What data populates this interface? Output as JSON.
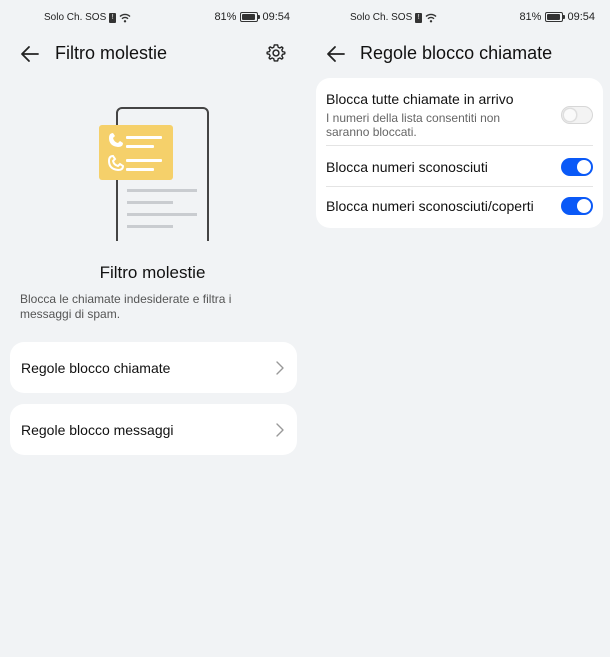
{
  "left": {
    "status": {
      "carrier": "Solo Ch. SOS",
      "battery": "81%",
      "time": "09:54"
    },
    "title": "Filtro molestie",
    "heading": "Filtro molestie",
    "description": "Blocca le chiamate indesiderate e filtra i messaggi di spam.",
    "rows": [
      {
        "label": "Regole blocco chiamate"
      },
      {
        "label": "Regole blocco messaggi"
      }
    ]
  },
  "right": {
    "status": {
      "carrier": "Solo Ch. SOS",
      "battery": "81%",
      "time": "09:54"
    },
    "title": "Regole blocco chiamate",
    "settings": [
      {
        "label": "Blocca tutte chiamate in arrivo",
        "sub": "I numeri della lista consentiti non saranno bloccati.",
        "on": false
      },
      {
        "label": "Blocca numeri sconosciuti",
        "on": true
      },
      {
        "label": "Blocca numeri sconosciuti/coperti",
        "on": true
      }
    ]
  },
  "colors": {
    "accent": "#0a59f7",
    "background": "#f1f3f5",
    "illustration": "#f5d06a"
  },
  "battery_level": 0.81
}
